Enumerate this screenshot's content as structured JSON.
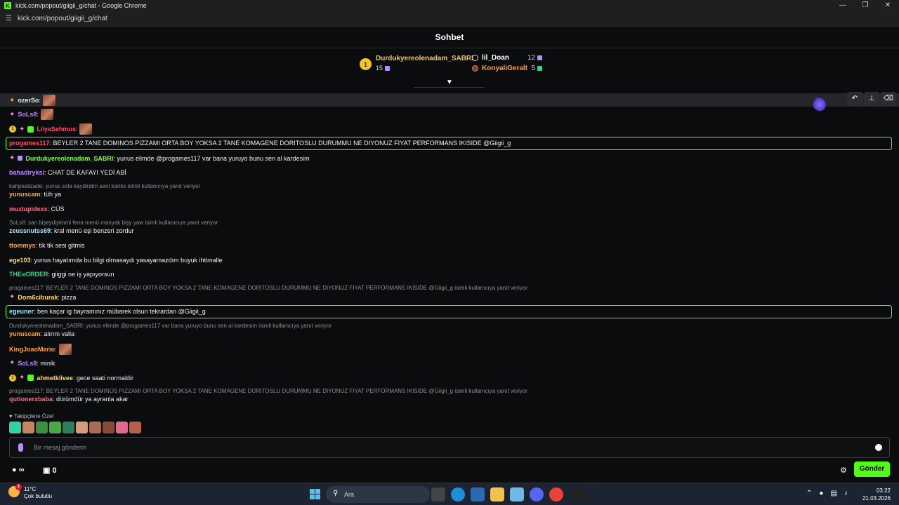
{
  "window": {
    "title": "kick.com/popout/giigii_g/chat - Google Chrome",
    "url": "kick.com/popout/giigii_g/chat"
  },
  "chat": {
    "header": "Sohbet"
  },
  "leaderboard": {
    "top": {
      "rank": "1",
      "name": "Durdukyereolenadam_SABRI",
      "count": "15"
    },
    "rows": [
      {
        "name": "lil_Doan",
        "count": "12"
      },
      {
        "name": "KonyaliGeralt",
        "count": "5"
      }
    ]
  },
  "messages": [
    {
      "user": "ozerSo",
      "text": ":",
      "color": "#e8e8ea"
    },
    {
      "user": "SoLs8",
      "text": ":",
      "color": "#b98cff"
    },
    {
      "user": "LiiyaSehmus",
      "text": ":",
      "color": "#ff4d6d"
    },
    {
      "user": "progames117",
      "text": ": BEYLER 2 TANE DOMINOS PIZZAMI ORTA BOY YOKSA 2 TANE KOMAGENE DORITOSLU DURUMMU NE DIYONUZ FIYAT PERFORMANS IKISIDE @Giigii_g",
      "color": "#ff4d6d"
    },
    {
      "user": "Durdukyereolenadam_SABRI",
      "text": ": yunus elimde @progames117 var bana yuruyo bunu sen al kardesim",
      "color": "#7cfc3f"
    },
    {
      "user": "bahadiryksi",
      "text": ": CHAT DE KAFAYI YEDİ ABİ",
      "color": "#b98cff"
    },
    {
      "user": "yunuscam",
      "text": ": tüh ya",
      "color": "#f4a54a"
    },
    {
      "user": "muzlupidexx",
      "text": ": CÜS",
      "color": "#ff6b8a"
    },
    {
      "user": "zeussnutss69",
      "text": ": kral menü eşi benzeri zordur",
      "color": "#9ae6ff"
    },
    {
      "user": "ttommys",
      "text": ": tik tik sesi gitmis",
      "color": "#f4a54a"
    },
    {
      "user": "ege103",
      "text": ": yunus hayatımda bu bilgi olmasaydı yasayamazdım buyuk ihtimalle",
      "color": "#ffd966"
    },
    {
      "user": "THExORDER",
      "text": ": giiggi ne iş yapıyorsun",
      "color": "#2fd38a"
    },
    {
      "user": "Dom6ciburak",
      "text": ": pizza",
      "color": "#ffd966"
    },
    {
      "user": "egeuner",
      "text": ": ben kaçar ig bayramınız mübarek olsun tekrardan @Giigii_g",
      "color": "#9ae6ff"
    },
    {
      "user": "yunuscam",
      "text": ": alırım valla",
      "color": "#f4a54a"
    },
    {
      "user": "KingJoaoMario",
      "text": ":",
      "color": "#ff9e3d"
    },
    {
      "user": "SoLs8",
      "text": ": minik",
      "color": "#b98cff"
    },
    {
      "user": "ahmetklivee",
      "text": ": gece saati normaldir",
      "color": "#ffd966"
    },
    {
      "user": "qutionerxbaba",
      "text": ": dürümdür ya ayranla akar",
      "color": "#ff6b8a"
    }
  ],
  "replies": [
    "kahpealizade: yunus sola kaydirdim seni kanks isimli kullanıcıya yanıt veriyor",
    "SoLs8: san bişeydiyimmi fena menü manyak bişy yaw isimli kullanıcıya yanıt veriyor",
    "progames117: BEYLER 2 TANE DOMINOS PIZZAMI ORTA BOY YOKSA 2 TANE KOMAGENE DORITOSLU DURUMMU NE DIYONUZ FIYAT PERFORMANS IKISIDE @Giigii_g isimli kullanıcıya yanıt veriyor",
    "Durdukyereolenadam_SABRI: yunus elimde @progames117 var bana yuruyo bunu sen al kardesim isimli kullanıcıya yanıt veriyor",
    "progames117: BEYLER 2 TANE DOMINOS PIZZAMI ORTA BOY YOKSA 2 TANE KOMAGENE DORITOSLU DURUMMU NE DIYONUZ FIYAT PERFORMANS IKISIDE @Giigii_g isimli kullanıcıya yanıt veriyor"
  ],
  "followers_label": "Takipçilere Özel",
  "input": {
    "placeholder": "Bir mesaj gönderin"
  },
  "footer": {
    "points": "∞",
    "store_count": "0",
    "send": "Gönder"
  },
  "taskbar": {
    "temp": "11°C",
    "weather": "Çok bulutlu",
    "search": "Ara",
    "time": "03:22",
    "date": "21.03.2026",
    "notif": "1"
  }
}
